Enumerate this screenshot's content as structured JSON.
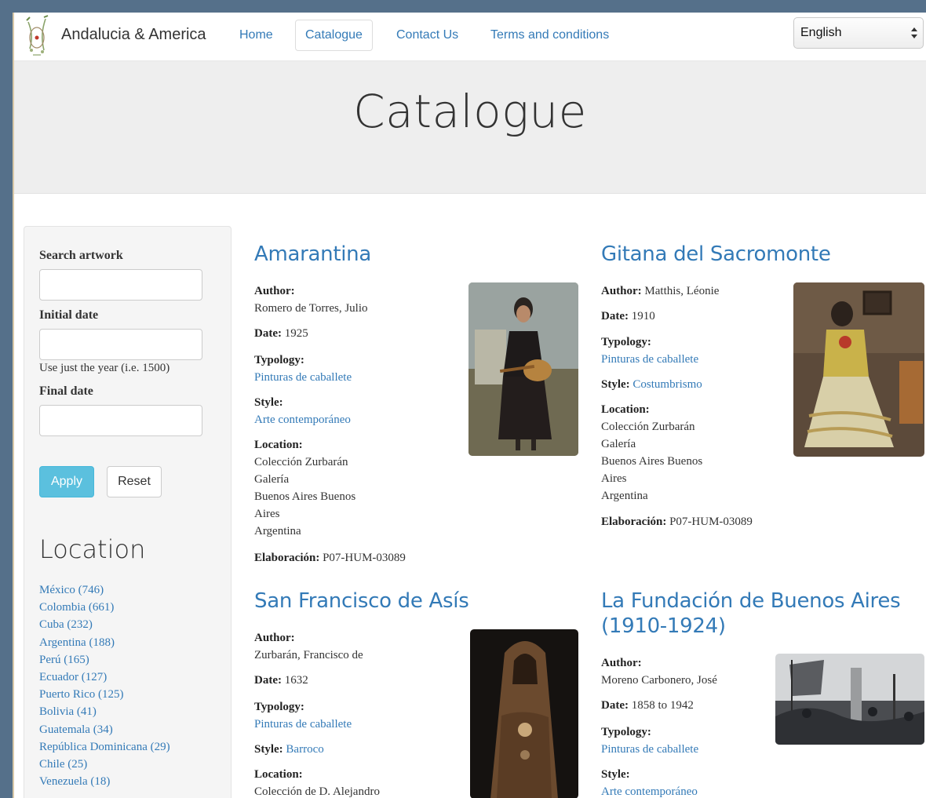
{
  "navbar": {
    "brand": "Andalucia & America",
    "links": [
      {
        "label": "Home",
        "active": false
      },
      {
        "label": "Catalogue",
        "active": true
      },
      {
        "label": "Contact Us",
        "active": false
      },
      {
        "label": "Terms and conditions",
        "active": false
      }
    ],
    "language": "English"
  },
  "hero": {
    "title": "Catalogue"
  },
  "sidebar": {
    "search_label": "Search artwork",
    "initial_date_label": "Initial date",
    "date_help": "Use just the year (i.e. 1500)",
    "final_date_label": "Final date",
    "apply_label": "Apply",
    "reset_label": "Reset",
    "location_heading": "Location",
    "locations": [
      "México (746)",
      "Colombia (661)",
      "Cuba (232)",
      "Argentina (188)",
      "Perú (165)",
      "Ecuador (127)",
      "Puerto Rico (125)",
      "Bolivia (41)",
      "Guatemala (34)",
      "República Dominicana (29)",
      "Chile (25)",
      "Venezuela (18)"
    ]
  },
  "labels": {
    "author": "Author:",
    "date": "Date:",
    "typology": "Typology:",
    "style": "Style:",
    "location": "Location:",
    "elaboracion": "Elaboración:"
  },
  "artworks": [
    {
      "title": "Amarantina",
      "author": "Romero de Torres, Julio",
      "date": "1925",
      "typology": "Pinturas de caballete",
      "style": "Arte contemporáneo",
      "location": [
        "Colección Zurbarán",
        "Galería",
        "Buenos Aires Buenos",
        "Aires",
        "Argentina"
      ],
      "elaboracion": "P07-HUM-03089"
    },
    {
      "title": "Gitana del Sacromonte",
      "author": "Matthis, Léonie",
      "date": "1910",
      "typology": "Pinturas de caballete",
      "style": "Costumbrismo",
      "location": [
        "Colección Zurbarán",
        "Galería",
        "Buenos Aires Buenos",
        "Aires",
        "Argentina"
      ],
      "elaboracion": "P07-HUM-03089"
    },
    {
      "title": "San Francisco de Asís",
      "author": "Zurbarán, Francisco de",
      "date": "1632",
      "typology": "Pinturas de caballete",
      "style": "Barroco",
      "location": [
        "Colección de D. Alejandro"
      ]
    },
    {
      "title_line1": "La Fundación de Buenos Aires",
      "title_line2": "(1910-1924)",
      "author": "Moreno Carbonero, José",
      "date": "1858 to 1942",
      "typology": "Pinturas de caballete",
      "style": "Arte contemporáneo"
    }
  ],
  "colors": {
    "link": "#337ab7",
    "apply_button": "#5bc0de",
    "hero_bg": "#eeeeee",
    "outer_bg": "#55708a"
  }
}
